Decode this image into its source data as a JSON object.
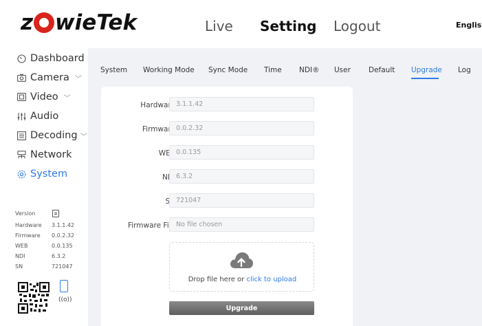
{
  "header": {
    "logo_left": "z",
    "logo_right": "wieTek",
    "nav": {
      "live": "Live",
      "setting": "Setting",
      "logout": "Logout"
    },
    "language": "English"
  },
  "sidebar": {
    "items": [
      {
        "label": "Dashboard",
        "icon": "dashboard-icon"
      },
      {
        "label": "Camera",
        "icon": "camera-icon",
        "expandable": true
      },
      {
        "label": "Video",
        "icon": "video-icon",
        "expandable": true
      },
      {
        "label": "Audio",
        "icon": "audio-icon"
      },
      {
        "label": "Decoding",
        "icon": "decoding-icon",
        "expandable": true
      },
      {
        "label": "Network",
        "icon": "network-icon"
      },
      {
        "label": "System",
        "icon": "system-icon",
        "active": true
      }
    ],
    "info": {
      "version_label": "Version",
      "rows": [
        {
          "key": "Hardware",
          "value": "3.1.1.42"
        },
        {
          "key": "Firmware",
          "value": "0.0.2.32"
        },
        {
          "key": "WEB",
          "value": "0.0.135"
        },
        {
          "key": "NDI",
          "value": "6.3.2"
        },
        {
          "key": "SN",
          "value": "721047"
        }
      ]
    }
  },
  "tabs": [
    {
      "label": "System"
    },
    {
      "label": "Working Mode"
    },
    {
      "label": "Sync Mode"
    },
    {
      "label": "Time"
    },
    {
      "label": "NDI®"
    },
    {
      "label": "User"
    },
    {
      "label": "Default"
    },
    {
      "label": "Upgrade",
      "active": true
    },
    {
      "label": "Log"
    }
  ],
  "form": {
    "hardware": {
      "label": "Hardware",
      "value": "3.1.1.42"
    },
    "firmware": {
      "label": "Firmware",
      "value": "0.0.2.32"
    },
    "web": {
      "label": "WEB",
      "value": "0.0.135"
    },
    "ndi": {
      "label": "NDI",
      "value": "6.3.2"
    },
    "sn": {
      "label": "SN",
      "value": "721047"
    },
    "firmware_file": {
      "label": "Firmware File",
      "value": "No file chosen"
    },
    "drop_text": "Drop file here or ",
    "drop_link": "click to upload",
    "upgrade_label": "Upgrade"
  },
  "colors": {
    "accent": "#2d7be6",
    "brand_red": "#d9241c",
    "panel_bg": "#f1f2f5"
  }
}
